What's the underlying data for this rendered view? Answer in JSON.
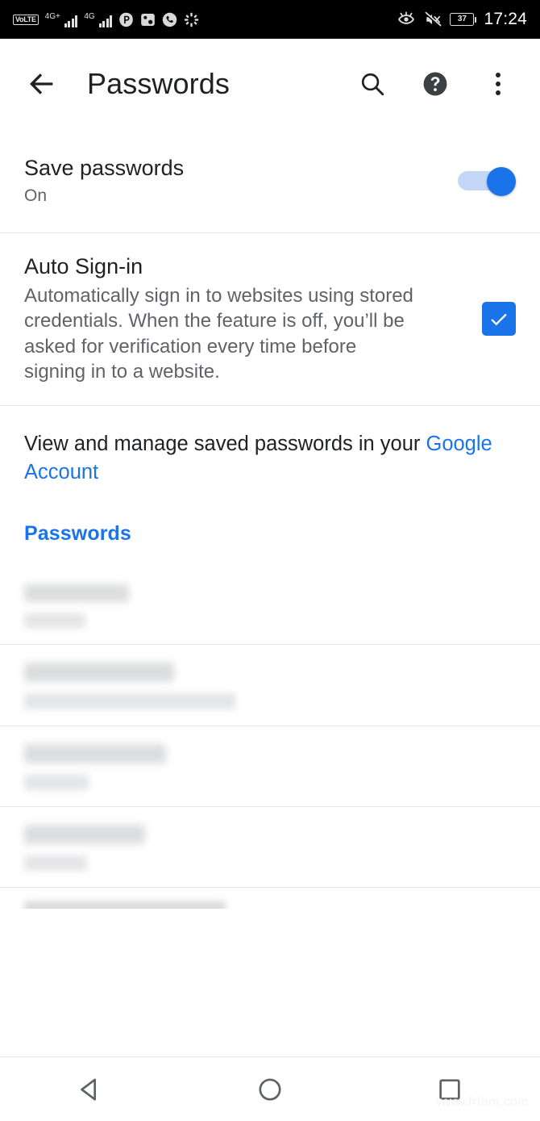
{
  "status_bar": {
    "volte_label": "VoLTE",
    "sim1_network": "4G+",
    "sim2_network": "4G",
    "icons": [
      "volte-badge",
      "signal-bars-sim1",
      "signal-bars-sim2",
      "p-app-icon",
      "gallery-icon",
      "phone-call-icon",
      "scatter-dots-icon",
      "eye-care-icon",
      "sound-muted-icon",
      "battery-icon"
    ],
    "battery_level": "37",
    "time": "17:24"
  },
  "toolbar": {
    "back_label": "Back",
    "title": "Passwords",
    "search_label": "Search",
    "help_label": "Help & feedback",
    "overflow_label": "More options"
  },
  "save_passwords": {
    "title": "Save passwords",
    "state": "On",
    "toggle_on": true,
    "track_color": "#c3d7f7",
    "thumb_color": "#1a73e8"
  },
  "auto_signin": {
    "title": "Auto Sign-in",
    "description": "Automatically sign in to websites using stored credentials. When the feature is off, you’ll be asked for verification every time before signing in to a website.",
    "checked": true,
    "checkbox_color": "#1a73e8"
  },
  "manage": {
    "text_before_link": "View and manage saved passwords in your ",
    "link_text": "Google Account",
    "link_color": "#1a73e8"
  },
  "section_header": {
    "label": "Passwords",
    "color": "#1a73e8"
  },
  "password_list": {
    "items": [
      {
        "name": "redacted-entry-1",
        "title_redacted": true,
        "subtitle_redacted": true,
        "title_width": 130,
        "subtitle_width": 76
      },
      {
        "name": "redacted-entry-2",
        "title_redacted": true,
        "subtitle_redacted": true,
        "title_width": 186,
        "subtitle_width": 262
      },
      {
        "name": "redacted-entry-3",
        "title_redacted": true,
        "subtitle_redacted": true,
        "title_width": 176,
        "subtitle_width": 80
      },
      {
        "name": "redacted-entry-4",
        "title_redacted": true,
        "subtitle_redacted": true,
        "title_width": 150,
        "subtitle_width": 78
      },
      {
        "name": "redacted-entry-5-cutoff",
        "title_redacted": true,
        "subtitle_redacted": false,
        "title_width": 250,
        "subtitle_width": 0
      }
    ]
  },
  "nav_bar": {
    "back_label": "Back",
    "home_label": "Home",
    "recents_label": "Recent apps"
  },
  "watermark": {
    "text": "www.frfam.com"
  }
}
